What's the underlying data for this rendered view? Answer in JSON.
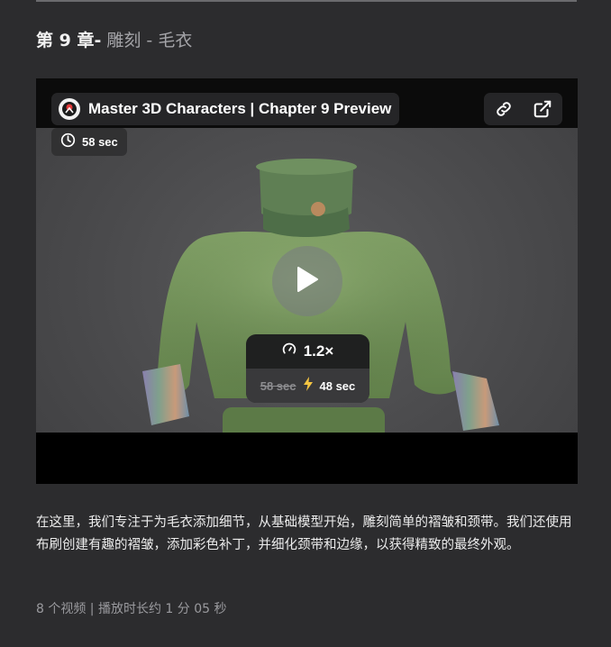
{
  "chapter": {
    "number_label": "第 9 章",
    "separator": "-",
    "subtitle": "雕刻 - 毛衣"
  },
  "video": {
    "title": "Master 3D Characters | Chapter 9 Preview",
    "duration": "58 sec",
    "speed": "1.2×",
    "original_duration": "58 sec",
    "sped_duration": "48 sec",
    "icons": {
      "logo": "brand-logo-icon",
      "link": "link-icon",
      "external": "external-link-icon",
      "clock": "clock-icon",
      "play": "play-icon",
      "speed": "speedometer-icon",
      "bolt": "lightning-icon"
    },
    "colors": {
      "accent_bolt": "#f5c542",
      "sweater": "#7a9a5e"
    }
  },
  "description": "在这里，我们专注于为毛衣添加细节，从基础模型开始，雕刻简单的褶皱和颈带。我们还使用布刷创建有趣的褶皱，添加彩色补丁，并细化颈带和边缘，以获得精致的最终外观。",
  "meta": "8 个视频 | 播放时长约 1 分 05 秒"
}
